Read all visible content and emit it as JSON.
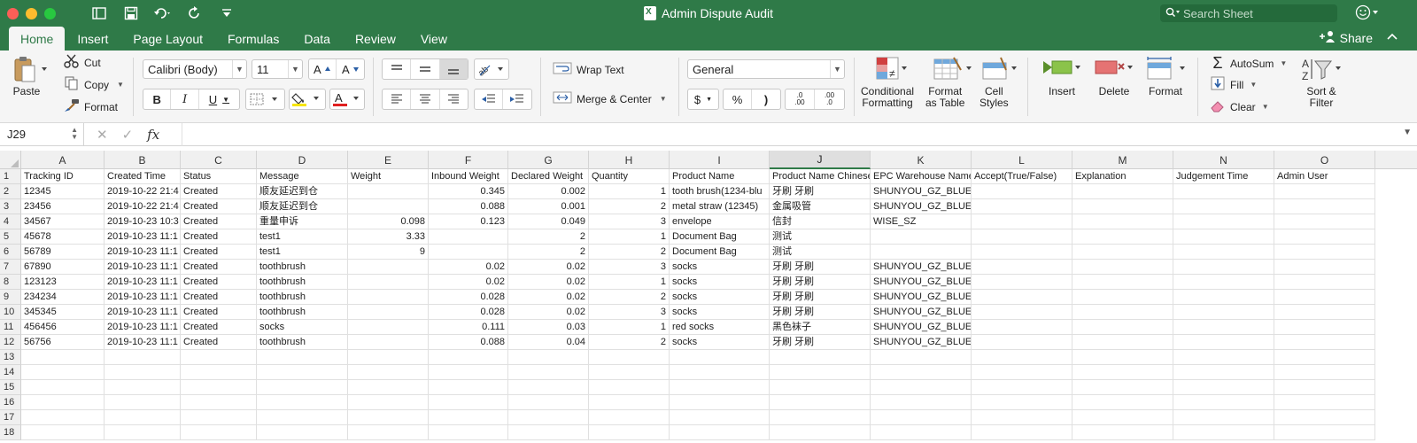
{
  "window": {
    "title": "Admin Dispute Audit",
    "search_placeholder": "Search Sheet"
  },
  "tabs": [
    "Home",
    "Insert",
    "Page Layout",
    "Formulas",
    "Data",
    "Review",
    "View"
  ],
  "share_label": "Share",
  "ribbon": {
    "paste": "Paste",
    "cut": "Cut",
    "copy": "Copy",
    "format_painter": "Format",
    "font_name": "Calibri (Body)",
    "font_size": "11",
    "bold": "B",
    "italic": "I",
    "underline": "U",
    "wrap_text": "Wrap Text",
    "merge_center": "Merge & Center",
    "number_format": "General",
    "currency": "$",
    "percent": "%",
    "comma": ")",
    "conditional_formatting": [
      "Conditional",
      "Formatting"
    ],
    "format_as_table": [
      "Format",
      "as Table"
    ],
    "cell_styles": [
      "Cell",
      "Styles"
    ],
    "insert": "Insert",
    "delete": "Delete",
    "format": "Format",
    "autosum": "AutoSum",
    "fill": "Fill",
    "clear": "Clear",
    "sort_filter": [
      "Sort &",
      "Filter"
    ],
    "inc_decimal": [
      ".0",
      ".00"
    ],
    "dec_decimal": [
      ".00",
      ".0"
    ]
  },
  "formula_bar": {
    "name_box": "J29",
    "formula": ""
  },
  "sheet": {
    "selected_column": "J",
    "columns": [
      "A",
      "B",
      "C",
      "D",
      "E",
      "F",
      "G",
      "H",
      "I",
      "J",
      "K",
      "L",
      "M",
      "N",
      "O"
    ],
    "row_numbers": [
      1,
      2,
      3,
      4,
      5,
      6,
      7,
      8,
      9,
      10,
      11,
      12,
      13,
      14,
      15,
      16,
      17,
      18
    ],
    "headers": [
      "Tracking ID",
      "Created Time",
      "Status",
      "Message",
      "Weight",
      "Inbound Weight",
      "Declared Weight",
      "Quantity",
      "Product Name",
      "Product Name Chinese",
      "EPC Warehouse Name",
      "Accept(True/False)",
      "Explanation",
      "Judgement Time",
      "Admin User"
    ],
    "rows": [
      [
        "12345",
        "2019-10-22 21:4",
        "Created",
        "顺友延迟到仓",
        "",
        "0.345",
        "0.002",
        "1",
        "tooth brush(1234-blu",
        "牙刷 牙刷",
        "SHUNYOU_GZ_BLUE",
        "",
        "",
        "",
        ""
      ],
      [
        "23456",
        "2019-10-22 21:4",
        "Created",
        "顺友延迟到仓",
        "",
        "0.088",
        "0.001",
        "2",
        "metal straw (12345)",
        "金属吸管",
        "SHUNYOU_GZ_BLUE",
        "",
        "",
        "",
        ""
      ],
      [
        "34567",
        "2019-10-23 10:3",
        "Created",
        "重量申诉",
        "0.098",
        "0.123",
        "0.049",
        "3",
        "envelope",
        "信封",
        "WISE_SZ",
        "",
        "",
        "",
        ""
      ],
      [
        "45678",
        "2019-10-23 11:1",
        "Created",
        "test1",
        "3.33",
        "",
        "2",
        "1",
        "Document Bag",
        "测试",
        "",
        "",
        "",
        "",
        ""
      ],
      [
        "56789",
        "2019-10-23 11:1",
        "Created",
        "test1",
        "9",
        "",
        "2",
        "2",
        "Document Bag",
        "测试",
        "",
        "",
        "",
        "",
        ""
      ],
      [
        "67890",
        "2019-10-23 11:1",
        "Created",
        "toothbrush",
        "",
        "0.02",
        "0.02",
        "3",
        "socks",
        "牙刷 牙刷",
        "SHUNYOU_GZ_BLUE",
        "",
        "",
        "",
        ""
      ],
      [
        "123123",
        "2019-10-23 11:1",
        "Created",
        "toothbrush",
        "",
        "0.02",
        "0.02",
        "1",
        "socks",
        "牙刷 牙刷",
        "SHUNYOU_GZ_BLUE",
        "",
        "",
        "",
        ""
      ],
      [
        "234234",
        "2019-10-23 11:1",
        "Created",
        "toothbrush",
        "",
        "0.028",
        "0.02",
        "2",
        "socks",
        "牙刷 牙刷",
        "SHUNYOU_GZ_BLUE",
        "",
        "",
        "",
        ""
      ],
      [
        "345345",
        "2019-10-23 11:1",
        "Created",
        "toothbrush",
        "",
        "0.028",
        "0.02",
        "3",
        "socks",
        "牙刷 牙刷",
        "SHUNYOU_GZ_BLUE",
        "",
        "",
        "",
        ""
      ],
      [
        "456456",
        "2019-10-23 11:1",
        "Created",
        "socks",
        "",
        "0.111",
        "0.03",
        "1",
        "red socks",
        "黑色袜子",
        "SHUNYOU_GZ_BLUE",
        "",
        "",
        "",
        ""
      ],
      [
        "56756",
        "2019-10-23 11:1",
        "Created",
        "toothbrush",
        "",
        "0.088",
        "0.04",
        "2",
        "socks",
        "牙刷 牙刷",
        "SHUNYOU_GZ_BLUE",
        "",
        "",
        "",
        ""
      ]
    ]
  },
  "colors": {
    "accent": "#2f7a48",
    "highlight": "#f7e500",
    "font_color": "#e02020"
  }
}
